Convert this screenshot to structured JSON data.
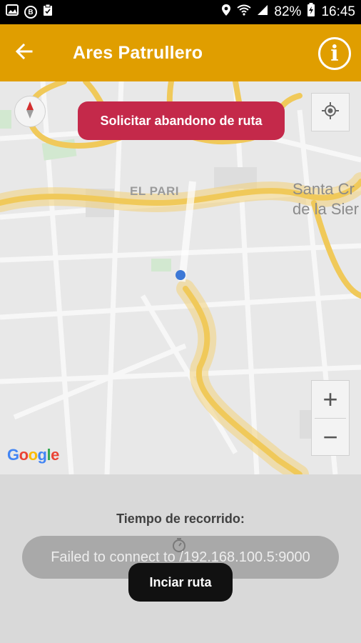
{
  "status_bar": {
    "left_icons": [
      "image-icon",
      "b-badge-icon",
      "clipboard-icon"
    ],
    "b_badge": "B",
    "battery": "82%",
    "time": "16:45"
  },
  "app_bar": {
    "title": "Ares Patrullero",
    "back_icon": "arrow-left-icon",
    "info_icon": "info-icon",
    "info_glyph": "i",
    "background": "#E09E00"
  },
  "map": {
    "abandon_button": "Solicitar abandono de ruta",
    "abandon_color": "#C4294A",
    "labels": {
      "district": "EL PARI",
      "place_line1": "Santa Cr",
      "place_line2": "de la Sier"
    },
    "zoom_in": "+",
    "zoom_out": "−",
    "logo": [
      "G",
      "o",
      "o",
      "g",
      "l",
      "e"
    ],
    "logo_colors": [
      "#4285F4",
      "#EA4335",
      "#FBBC05",
      "#4285F4",
      "#34A853",
      "#EA4335"
    ]
  },
  "bottom": {
    "travel_time_label": "Tiempo de recorrido:",
    "toast": "Failed to connect to /192.168.100.5:9000",
    "start_button": "Inciar ruta"
  }
}
